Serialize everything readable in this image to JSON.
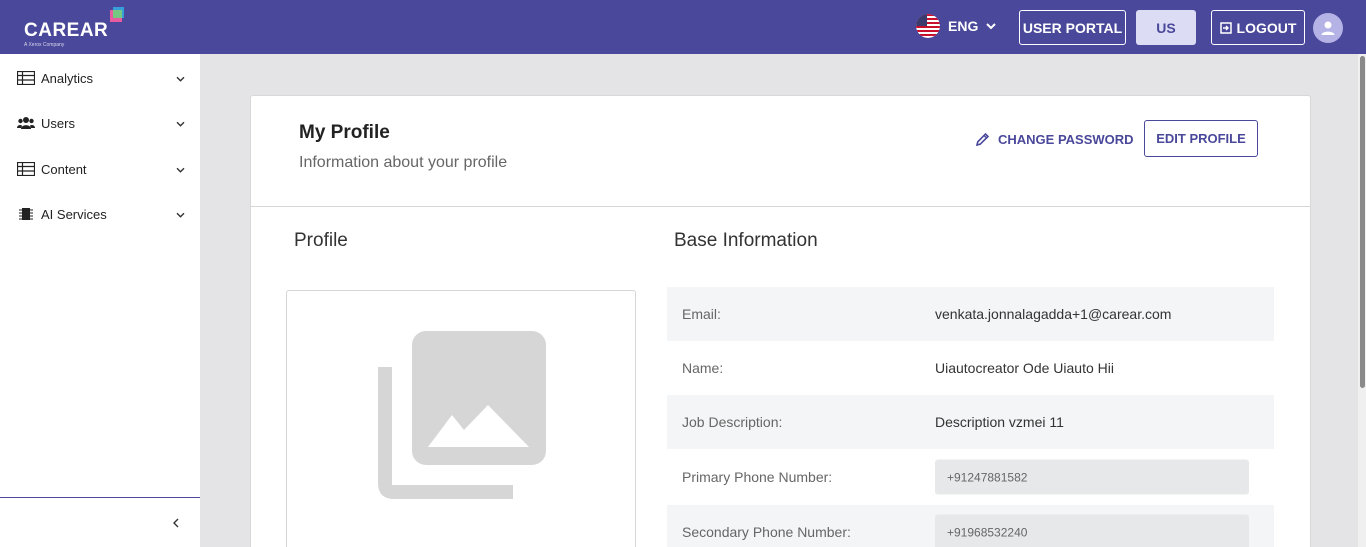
{
  "header": {
    "logo_text": "CAREAR",
    "logo_tagline": "A Xerox Company",
    "language": "ENG",
    "user_portal_label": "USER PORTAL",
    "region_label": "US",
    "logout_label": "LOGOUT",
    "colors": {
      "bar": "#4a489a",
      "region_bg": "#dcdcf4"
    }
  },
  "sidebar": {
    "items": [
      {
        "label": "Analytics",
        "icon": "table-icon"
      },
      {
        "label": "Users",
        "icon": "users-icon"
      },
      {
        "label": "Content",
        "icon": "table-icon"
      },
      {
        "label": "AI Services",
        "icon": "chip-icon"
      }
    ]
  },
  "card": {
    "title": "My Profile",
    "subtitle": "Information about your profile",
    "change_password_label": "CHANGE PASSWORD",
    "edit_profile_label": "EDIT PROFILE"
  },
  "profile_section": {
    "title": "Profile"
  },
  "base_info": {
    "title": "Base Information",
    "rows": [
      {
        "label": "Email:",
        "value": "venkata.jonnalagadda+1@carear.com"
      },
      {
        "label": "Name:",
        "value": "Uiautocreator Ode Uiauto Hii"
      },
      {
        "label": "Job Description:",
        "value": "Description vzmei 11"
      },
      {
        "label": "Primary Phone Number:",
        "value": "+91247881582"
      },
      {
        "label": "Secondary Phone Number:",
        "value": "+91968532240"
      }
    ]
  }
}
